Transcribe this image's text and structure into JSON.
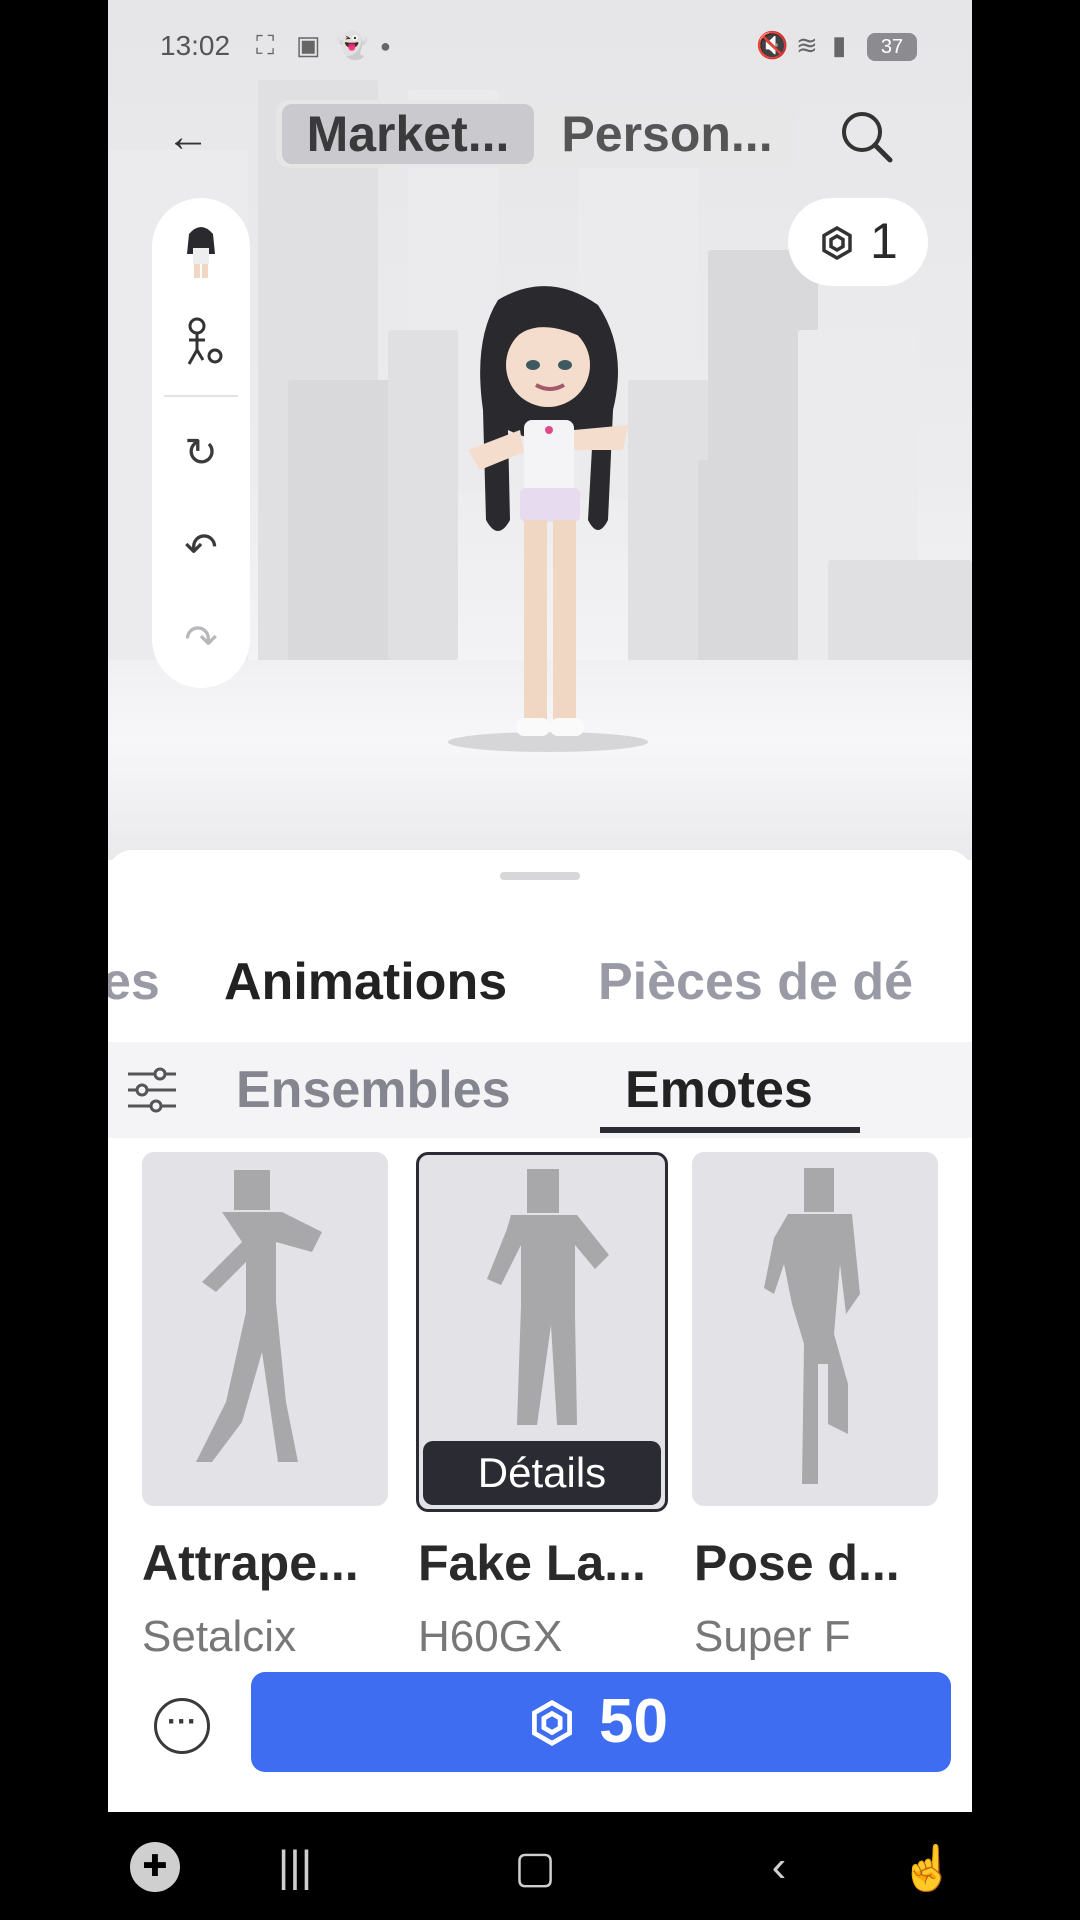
{
  "status_bar": {
    "time": "13:02",
    "battery": "37"
  },
  "header": {
    "tabs": [
      "Market...",
      "Person..."
    ],
    "currency_balance": "1"
  },
  "tools": [
    "avatar-thumbnail",
    "avatar-settings-icon",
    "rotate-icon",
    "undo-icon",
    "redo-icon"
  ],
  "category_tabs": [
    "es",
    "Animations",
    "Pièces de dé"
  ],
  "sub_tabs": [
    "Ensembles",
    "Emotes"
  ],
  "items": [
    {
      "name": "Attrape...",
      "creator": "Setalcix",
      "selected": false
    },
    {
      "name": "Fake La...",
      "creator": "H60GX",
      "selected": true,
      "details_label": "Détails"
    },
    {
      "name": "Pose d...",
      "creator": "Super F",
      "selected": false
    }
  ],
  "purchase": {
    "price": "50"
  },
  "colors": {
    "accent_blue": "#3e6df1",
    "dark": "#2b2b33"
  }
}
